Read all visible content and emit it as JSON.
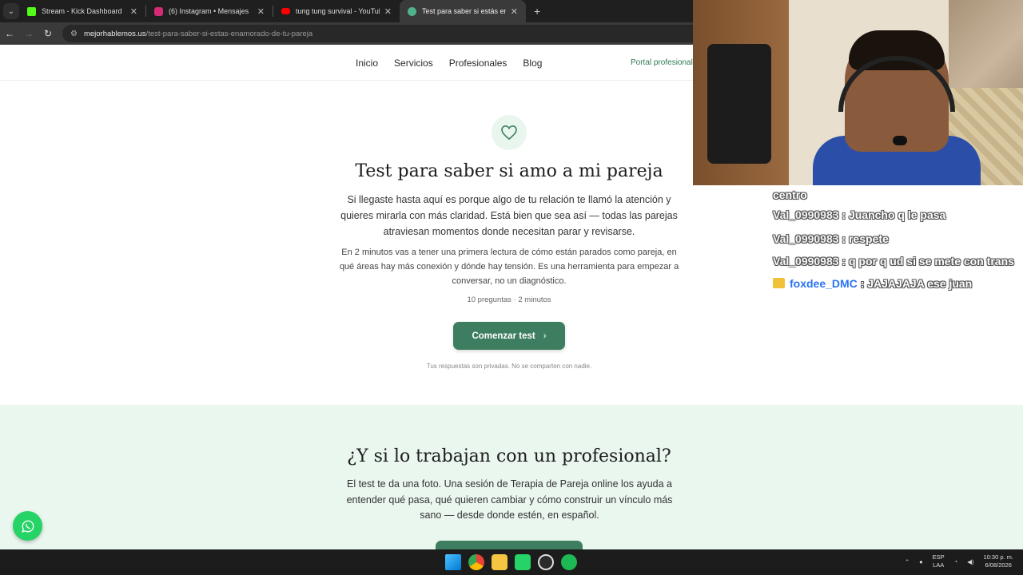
{
  "browser": {
    "tabs": [
      {
        "title": "Stream - Kick Dashboard",
        "favicon_color": "#53fc18"
      },
      {
        "title": "(6) Instagram • Mensajes",
        "favicon_color": "#d62976"
      },
      {
        "title": "tung tung survival - YouTube",
        "favicon_color": "#ff0000"
      },
      {
        "title": "Test para saber si estás enamor",
        "favicon_color": "#4fb38a"
      }
    ],
    "url_host": "mejorhablemos.us",
    "url_path": "/test-para-saber-si-estas-enamorado-de-tu-pareja"
  },
  "site_nav": {
    "links": [
      "Inicio",
      "Servicios",
      "Profesionales",
      "Blog"
    ],
    "portal": "Portal profesional"
  },
  "hero": {
    "title": "Test para saber si amo a mi pareja",
    "lead": "Si llegaste hasta aquí es porque algo de tu relación te llamó la atención y quieres mirarla con más claridad. Está bien que sea así — todas las parejas atraviesan momentos donde necesitan parar y revisarse.",
    "sub": "En 2 minutos vas a tener una primera lectura de cómo están parados como pareja, en qué áreas hay más conexión y dónde hay tensión. Es una herramienta para empezar a conversar, no un diagnóstico.",
    "meta": "10 preguntas · 2 minutos",
    "cta": "Comenzar test",
    "privacy": "Tus respuestas son privadas. No se comparten con nadie."
  },
  "pro_section": {
    "title": "¿Y si lo trabajan con un profesional?",
    "text": "El test te da una foto. Una sesión de Terapia de Pareja online los ayuda a entender qué pasa, qué quieren cambiar y cómo construir un vínculo más sano — desde donde estén, en español."
  },
  "chat": {
    "fragment": "centro",
    "messages": [
      {
        "user": "Val_0990983",
        "text": ": Juancho q le pasa"
      },
      {
        "user": "Val_0990983",
        "text": ": respete"
      },
      {
        "user": "Val_0990983",
        "text": ": q por q ud si se mete con trans"
      },
      {
        "user": "foxdee_DMC",
        "text": ": JAJAJAJA ese juan"
      }
    ]
  },
  "taskbar": {
    "lang_top": "ESP",
    "lang_bottom": "LAA",
    "time": "10:30 p. m.",
    "date": "6/08/2026"
  },
  "colors": {
    "accent_green": "#3e7e60",
    "soft_green_bg": "#eaf7ef",
    "whatsapp": "#25d366"
  }
}
